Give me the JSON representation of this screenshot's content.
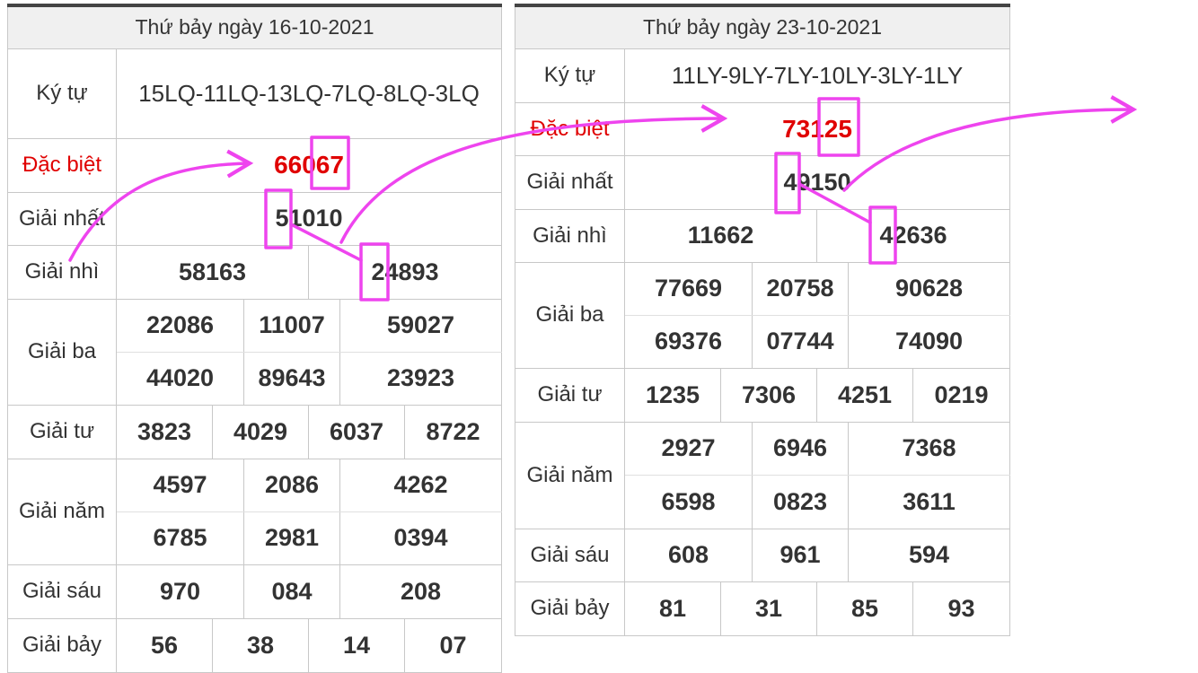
{
  "left": {
    "header": "Thứ bảy ngày 16-10-2021",
    "labels": {
      "ky_tu": "Ký tự",
      "dac_biet": "Đặc biệt",
      "giai_nhat": "Giải nhất",
      "giai_nhi": "Giải nhì",
      "giai_ba": "Giải ba",
      "giai_tu": "Giải tư",
      "giai_nam": "Giải năm",
      "giai_sau": "Giải sáu",
      "giai_bay": "Giải bảy"
    },
    "ky_tu": "15LQ-11LQ-13LQ-7LQ-8LQ-3LQ",
    "dac_biet": "66067",
    "giai_nhat": "51010",
    "giai_nhi": [
      "58163",
      "24893"
    ],
    "giai_ba": [
      "22086",
      "11007",
      "59027",
      "44020",
      "89643",
      "23923"
    ],
    "giai_tu": [
      "3823",
      "4029",
      "6037",
      "8722"
    ],
    "giai_nam": [
      "4597",
      "2086",
      "4262",
      "6785",
      "2981",
      "0394"
    ],
    "giai_sau": [
      "970",
      "084",
      "208"
    ],
    "giai_bay": [
      "56",
      "38",
      "14",
      "07"
    ]
  },
  "right": {
    "header": "Thứ bảy ngày 23-10-2021",
    "labels": {
      "ky_tu": "Ký tự",
      "dac_biet": "Đặc biệt",
      "giai_nhat": "Giải nhất",
      "giai_nhi": "Giải nhì",
      "giai_ba": "Giải ba",
      "giai_tu": "Giải tư",
      "giai_nam": "Giải năm",
      "giai_sau": "Giải sáu",
      "giai_bay": "Giải bảy"
    },
    "ky_tu": "11LY-9LY-7LY-10LY-3LY-1LY",
    "dac_biet": "73125",
    "giai_nhat": "49150",
    "giai_nhi": [
      "11662",
      "42636"
    ],
    "giai_ba": [
      "77669",
      "20758",
      "90628",
      "69376",
      "07744",
      "74090"
    ],
    "giai_tu": [
      "1235",
      "7306",
      "4251",
      "0219"
    ],
    "giai_nam": [
      "2927",
      "6946",
      "7368",
      "6598",
      "0823",
      "3611"
    ],
    "giai_sau": [
      "608",
      "961",
      "594"
    ],
    "giai_bay": [
      "81",
      "31",
      "85",
      "93"
    ]
  },
  "annotation": {
    "color": "#ee44ee",
    "marker_icons": [
      "curved-arrow-icon",
      "highlight-box-icon",
      "connector-line-icon"
    ]
  }
}
